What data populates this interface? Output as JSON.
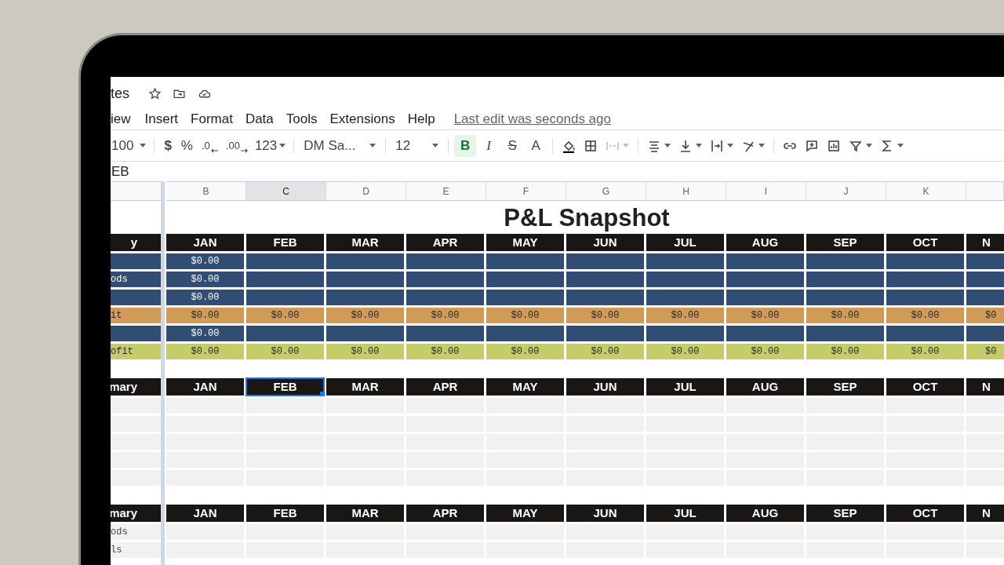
{
  "doc": {
    "title": "tes"
  },
  "menu": [
    {
      "label": "iew"
    },
    {
      "label": "Insert"
    },
    {
      "label": "Format"
    },
    {
      "label": "Data"
    },
    {
      "label": "Tools"
    },
    {
      "label": "Extensions"
    },
    {
      "label": "Help"
    }
  ],
  "last_edit": "Last edit was seconds ago",
  "toolbar": {
    "zoom": "100",
    "currency": "$",
    "percent": "%",
    "dec_less": ".0",
    "dec_more": ".00",
    "number_format": "123",
    "font": "DM Sa...",
    "font_size": "12",
    "text_styles": [
      {
        "kind": "bold",
        "label": "B",
        "selected": true
      },
      {
        "kind": "italic",
        "label": "I",
        "selected": false
      },
      {
        "kind": "strike",
        "label": "S",
        "selected": false
      },
      {
        "kind": "color",
        "label": "A",
        "selected": false
      }
    ]
  },
  "formula_bar": {
    "value": "EB"
  },
  "column_headers": [
    {
      "selected": false
    },
    {
      "label": "B",
      "selected": false
    },
    {
      "label": "C",
      "selected": true
    },
    {
      "label": "D",
      "selected": false
    },
    {
      "label": "E",
      "selected": false
    },
    {
      "label": "F",
      "selected": false
    },
    {
      "label": "G",
      "selected": false
    },
    {
      "label": "H",
      "selected": false
    },
    {
      "label": "I",
      "selected": false
    },
    {
      "label": "J",
      "selected": false
    },
    {
      "label": "K",
      "selected": false
    },
    {
      "selected": false
    }
  ],
  "sheet_title": "P&L Snapshot",
  "sections": [
    {
      "label": "y",
      "months": [
        {
          "label": "JAN",
          "selected": false
        },
        {
          "label": "FEB",
          "selected": false
        },
        {
          "label": "MAR",
          "selected": false
        },
        {
          "label": "APR",
          "selected": false
        },
        {
          "label": "MAY",
          "selected": false
        },
        {
          "label": "JUN",
          "selected": false
        },
        {
          "label": "JUL",
          "selected": false
        },
        {
          "label": "AUG",
          "selected": false
        },
        {
          "label": "SEP",
          "selected": false
        },
        {
          "label": "OCT",
          "selected": false
        },
        {
          "label": "N",
          "selected": false
        }
      ],
      "rows": [
        {
          "kind": "blue",
          "values": [
            "$0.00"
          ]
        },
        {
          "label": "ods",
          "kind": "blue",
          "values": [
            "$0.00"
          ]
        },
        {
          "kind": "blue",
          "values": [
            "$0.00"
          ]
        },
        {
          "label": "it",
          "kind": "orange",
          "values": [
            "$0.00",
            "$0.00",
            "$0.00",
            "$0.00",
            "$0.00",
            "$0.00",
            "$0.00",
            "$0.00",
            "$0.00",
            "$0.00",
            "$0"
          ]
        },
        {
          "kind": "blue",
          "values": [
            "$0.00"
          ]
        },
        {
          "label": "ofit",
          "kind": "green",
          "values": [
            "$0.00",
            "$0.00",
            "$0.00",
            "$0.00",
            "$0.00",
            "$0.00",
            "$0.00",
            "$0.00",
            "$0.00",
            "$0.00",
            "$0"
          ]
        }
      ]
    },
    {
      "label": "mary",
      "months": [
        {
          "label": "JAN",
          "selected": false
        },
        {
          "label": "FEB",
          "selected": true
        },
        {
          "label": "MAR",
          "selected": false
        },
        {
          "label": "APR",
          "selected": false
        },
        {
          "label": "MAY",
          "selected": false
        },
        {
          "label": "JUN",
          "selected": false
        },
        {
          "label": "JUL",
          "selected": false
        },
        {
          "label": "AUG",
          "selected": false
        },
        {
          "label": "SEP",
          "selected": false
        },
        {
          "label": "OCT",
          "selected": false
        },
        {
          "label": "N",
          "selected": false
        }
      ],
      "rows": [
        {
          "kind": "gray"
        },
        {
          "kind": "gray"
        },
        {
          "kind": "gray"
        },
        {
          "kind": "gray"
        },
        {
          "kind": "gray"
        }
      ]
    },
    {
      "label": "mary",
      "months": [
        {
          "label": "JAN",
          "selected": false
        },
        {
          "label": "FEB",
          "selected": false
        },
        {
          "label": "MAR",
          "selected": false
        },
        {
          "label": "APR",
          "selected": false
        },
        {
          "label": "MAY",
          "selected": false
        },
        {
          "label": "JUN",
          "selected": false
        },
        {
          "label": "JUL",
          "selected": false
        },
        {
          "label": "AUG",
          "selected": false
        },
        {
          "label": "SEP",
          "selected": false
        },
        {
          "label": "OCT",
          "selected": false
        },
        {
          "label": "N",
          "selected": false
        }
      ],
      "rows": [
        {
          "label": "ods",
          "kind": "gray"
        },
        {
          "label": "ls",
          "kind": "gray"
        }
      ]
    }
  ]
}
